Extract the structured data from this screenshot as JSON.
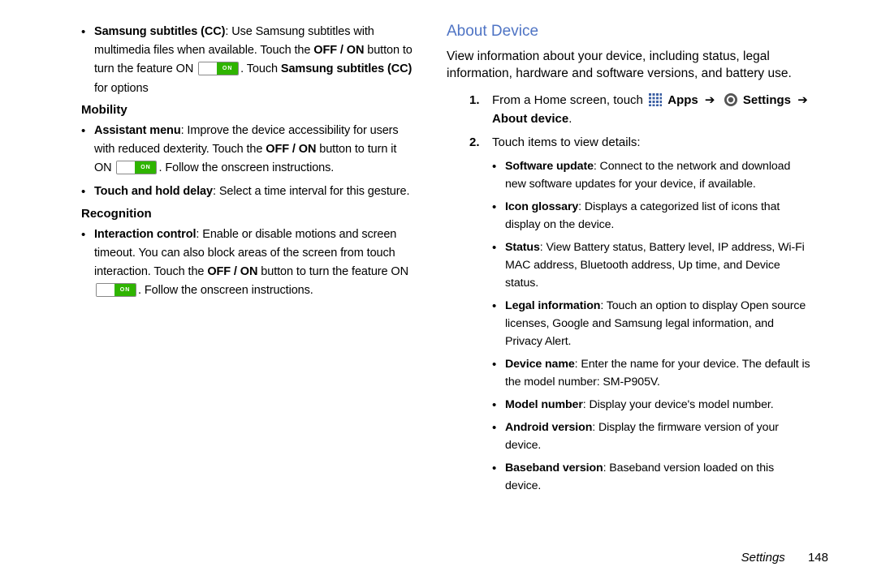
{
  "left": {
    "items": {
      "subtitles": {
        "b1": "Samsung subtitles (CC)",
        "t1": ": Use Samsung subtitles with multimedia files when available. Touch the ",
        "b2": "OFF / ON",
        "t2": " button to turn the feature ON ",
        "t3": ". Touch ",
        "b3": "Samsung subtitles (CC)",
        "t4": " for options"
      }
    },
    "mobility_head": "Mobility",
    "mobility": {
      "assistant": {
        "b1": "Assistant menu",
        "t1": ": Improve the device accessibility for users with reduced dexterity. Touch the ",
        "b2": "OFF / ON",
        "t2": " button to turn it ON ",
        "t3": ". Follow the onscreen instructions."
      },
      "touchhold": {
        "b1": "Touch and hold delay",
        "t1": ": Select a time interval for this gesture."
      }
    },
    "recognition_head": "Recognition",
    "recognition": {
      "interaction": {
        "b1": "Interaction control",
        "t1": ": Enable or disable motions and screen timeout. You can also block areas of the screen from touch interaction. Touch the ",
        "b2": "OFF / ON",
        "t2": " button to turn the feature ON ",
        "t3": ". Follow the onscreen instructions."
      }
    }
  },
  "right": {
    "title": "About Device",
    "intro": "View information about your device, including status, legal information, hardware and software versions, and battery use.",
    "step1": {
      "t1": "From a Home screen, touch ",
      "apps": "Apps",
      "arrow": "➔",
      "settings": "Settings",
      "about": "About device",
      "period": "."
    },
    "step2_text": "Touch items to view details:",
    "details": {
      "software": {
        "b": "Software update",
        "t": ": Connect to the network and download new software updates for your device, if available."
      },
      "iconglossary": {
        "b": "Icon glossary",
        "t": ": Displays a categorized list of icons that display on the device."
      },
      "status": {
        "b": "Status",
        "t": ": View Battery status, Battery level, IP address, Wi-Fi MAC address, Bluetooth address, Up time, and Device status."
      },
      "legal": {
        "b": "Legal information",
        "t": ": Touch an option to display Open source licenses, Google and Samsung legal information, and Privacy Alert."
      },
      "devicename": {
        "b": "Device name",
        "t": ": Enter the name for your device. The default is the model number: SM-P905V."
      },
      "model": {
        "b": "Model number",
        "t": ": Display your device's model number."
      },
      "android": {
        "b": "Android version",
        "t": ": Display the firmware version of your device."
      },
      "baseband": {
        "b": "Baseband version",
        "t": ": Baseband version loaded on this device."
      }
    }
  },
  "footer": {
    "section": "Settings",
    "page": "148"
  },
  "toggle_label": "ON"
}
